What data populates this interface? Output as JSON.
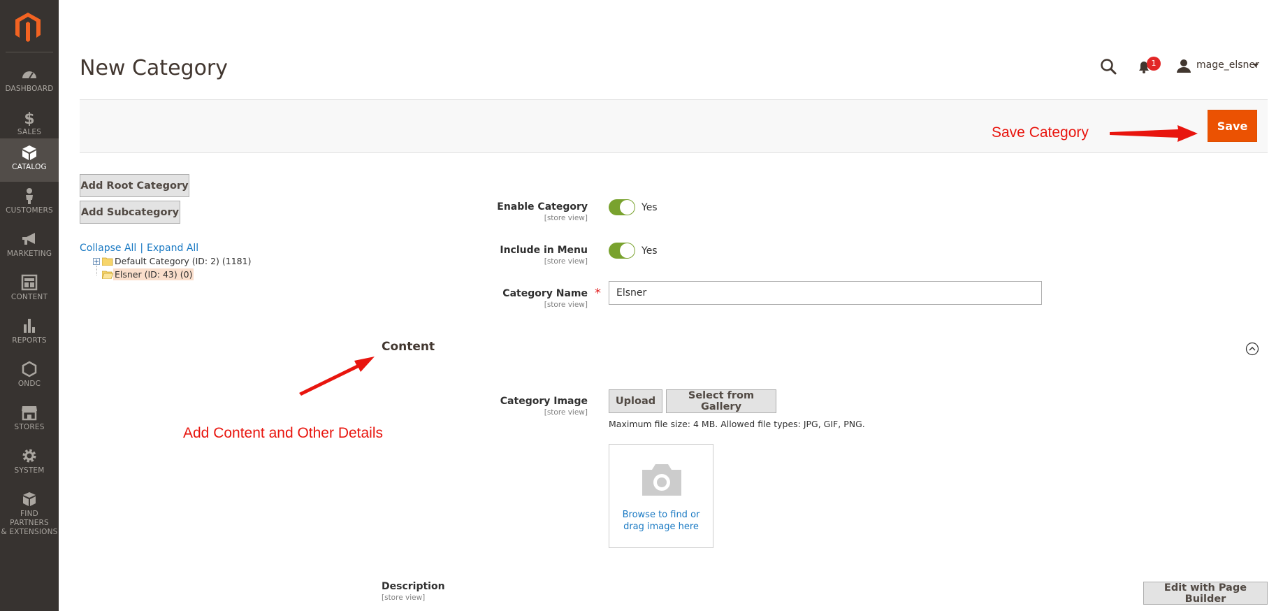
{
  "sidebar": {
    "logo": "magento-logo",
    "items": [
      {
        "label": "DASHBOARD",
        "icon": "dashboard-icon"
      },
      {
        "label": "SALES",
        "icon": "dollar-icon"
      },
      {
        "label": "CATALOG",
        "icon": "box-icon",
        "active": true
      },
      {
        "label": "CUSTOMERS",
        "icon": "person-icon"
      },
      {
        "label": "MARKETING",
        "icon": "megaphone-icon"
      },
      {
        "label": "CONTENT",
        "icon": "content-icon"
      },
      {
        "label": "REPORTS",
        "icon": "bar-chart-icon"
      },
      {
        "label": "ONDC",
        "icon": "hexagon-icon"
      },
      {
        "label": "STORES",
        "icon": "store-icon"
      },
      {
        "label": "SYSTEM",
        "icon": "gear-icon"
      },
      {
        "label_line1": "FIND PARTNERS",
        "label_line2": "& EXTENSIONS",
        "icon": "extensions-icon"
      }
    ]
  },
  "header": {
    "title": "New Category",
    "notification_count": "1",
    "username": "mage_elsner"
  },
  "actions": {
    "save_label": "Save"
  },
  "annotations": {
    "save": "Save Category",
    "content": "Add Content and Other Details",
    "color": "#e8150e"
  },
  "tree": {
    "add_root_label": "Add Root Category",
    "add_sub_label": "Add Subcategory",
    "collapse_all": "Collapse All",
    "separator": "|",
    "expand_all": "Expand All",
    "nodes": [
      {
        "label": "Default Category (ID: 2) (1181)"
      },
      {
        "label": "Elsner (ID: 43) (0)",
        "selected": true
      }
    ]
  },
  "form": {
    "scope_text": "[store view]",
    "enable_category": {
      "label": "Enable Category",
      "value_label": "Yes",
      "on": true
    },
    "include_in_menu": {
      "label": "Include in Menu",
      "value_label": "Yes",
      "on": true
    },
    "category_name": {
      "label": "Category Name",
      "value": "Elsner",
      "required_mark": "*"
    }
  },
  "content_section": {
    "title": "Content",
    "category_image": {
      "label": "Category Image",
      "upload_label": "Upload",
      "gallery_label": "Select from Gallery",
      "hint": "Maximum file size: 4 MB. Allowed file types: JPG, GIF, PNG.",
      "browse_line1": "Browse to find or",
      "browse_line2": "drag image here"
    },
    "description": {
      "label": "Description",
      "page_builder_label": "Edit with Page Builder"
    }
  },
  "colors": {
    "sidebar_bg": "#373330",
    "accent": "#eb5202",
    "toggle_on": "#79a22e",
    "link": "#1979c3"
  }
}
